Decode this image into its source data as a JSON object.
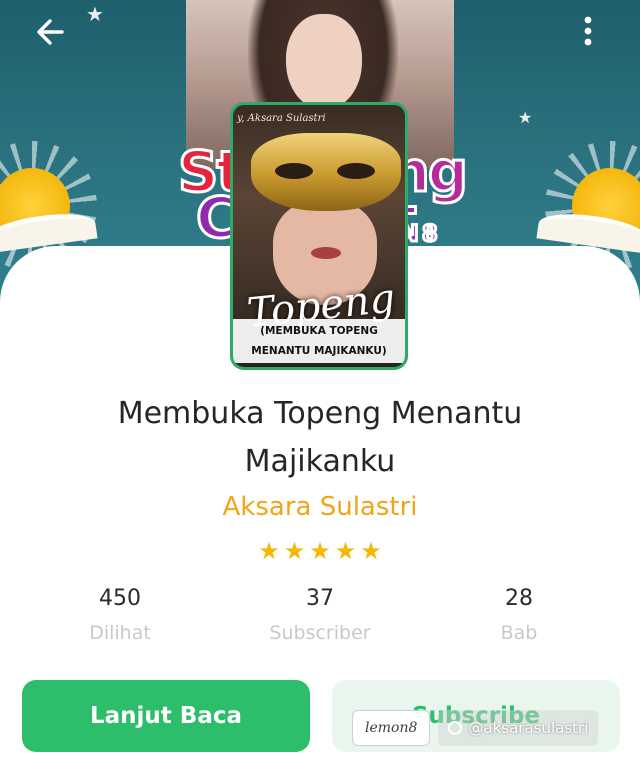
{
  "header": {
    "back_icon": "arrow-left-icon",
    "more_icon": "more-vertical-icon"
  },
  "banner": {
    "contest_text": [
      "St",
      "C",
      "ng",
      "t",
      "N 8"
    ]
  },
  "cover": {
    "author_line": "y, Aksara Sulastri",
    "title": "Topeng",
    "subtitle": "(MEMBUKA TOPENG MENANTU MAJIKANKU)"
  },
  "book": {
    "title": "Membuka Topeng Menantu Majikanku",
    "author": "Aksara Sulastri",
    "rating": 5,
    "stars": [
      "★",
      "★",
      "★",
      "★",
      "★"
    ]
  },
  "stats": [
    {
      "value": "450",
      "label": "Dilihat"
    },
    {
      "value": "37",
      "label": "Subscriber"
    },
    {
      "value": "28",
      "label": "Bab"
    }
  ],
  "actions": {
    "primary_label": "Lanjut Baca",
    "secondary_label": "Subscribe"
  },
  "watermark": {
    "logo_text": "lemon8",
    "handle": "@aksarasulastri"
  },
  "colors": {
    "accent_green": "#2dbe6c",
    "author_orange": "#f0a51a",
    "star_yellow": "#f5b800",
    "banner_teal": "#2b7380"
  }
}
